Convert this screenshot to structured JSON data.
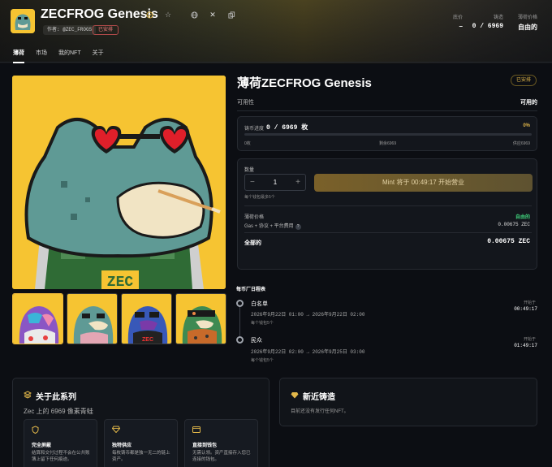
{
  "collection": {
    "title": "ZECFROG Genesis",
    "author": "作者: @ZEC_FROGS",
    "status_badge": "已安排"
  },
  "header_stats": [
    {
      "label": "底价",
      "value": "–"
    },
    {
      "label": "铸造",
      "value": "0 / 6969"
    },
    {
      "label": "薄荷价格",
      "value": "自由的"
    }
  ],
  "tabs": [
    "薄荷",
    "市场",
    "我的NFT",
    "关于"
  ],
  "mint": {
    "title": "薄荷ZECFROG Genesis",
    "badge": "已安排",
    "availability_label": "可用性",
    "availability_value": "可用的",
    "progress_label": "铸币进度",
    "progress_value": "0 / 6969 枚",
    "progress_pct": "0%",
    "progress_fraction": 0,
    "progress_minted": "0枚",
    "progress_remaining": "剩余6969",
    "progress_total": "供应6969",
    "quantity_label": "数量",
    "quantity_minus": "−",
    "quantity_value": "1",
    "quantity_plus": "+",
    "quantity_note": "每个钱包最多5个",
    "mint_button": "Mint 将于 00:49:17 开始营业",
    "price_label": "薄荷价格",
    "price_value": "自由的",
    "gas_label": "Gas + 协议 + 平台费用",
    "gas_help": "?",
    "gas_value": "0.00675 ZEC",
    "total_label": "全部的",
    "total_value": "0.00675 ZEC"
  },
  "schedule": {
    "heading": "每币厂日程表",
    "phases": [
      {
        "name": "白名单",
        "dates": "2026年9月22日 01:00 → 2026年9月22日 02:00",
        "note": "每个钱包5个",
        "status_label": "开始于",
        "countdown": "00:49:17"
      },
      {
        "name": "民众",
        "dates": "2026年9月22日 02:00 → 2026年9月25日 03:00",
        "note": "每个钱包5个",
        "status_label": "开始于",
        "countdown": "01:49:17"
      }
    ]
  },
  "about": {
    "heading": "关于此系列",
    "subtitle": "Zec 上的 6969 像素青蛙",
    "features": [
      {
        "icon": "shield-icon",
        "title": "完全屏蔽",
        "desc": "结算和交付过程不会在公共账簿上留下任何痕迹。"
      },
      {
        "icon": "gem-icon",
        "title": "独特供应",
        "desc": "每枚铸币都是独一无二的链上资产。"
      },
      {
        "icon": "wallet-icon",
        "title": "直接到钱包",
        "desc": "无需认领。资产直接存入您已连接的钱包。"
      }
    ]
  },
  "recent": {
    "heading": "新近铸造",
    "text": "目前还没有发行任何NFT。"
  },
  "colors": {
    "accent": "#e3b84a",
    "background": "#0c0e13",
    "card": "#13161c",
    "frog_yellow": "#f6c432"
  }
}
